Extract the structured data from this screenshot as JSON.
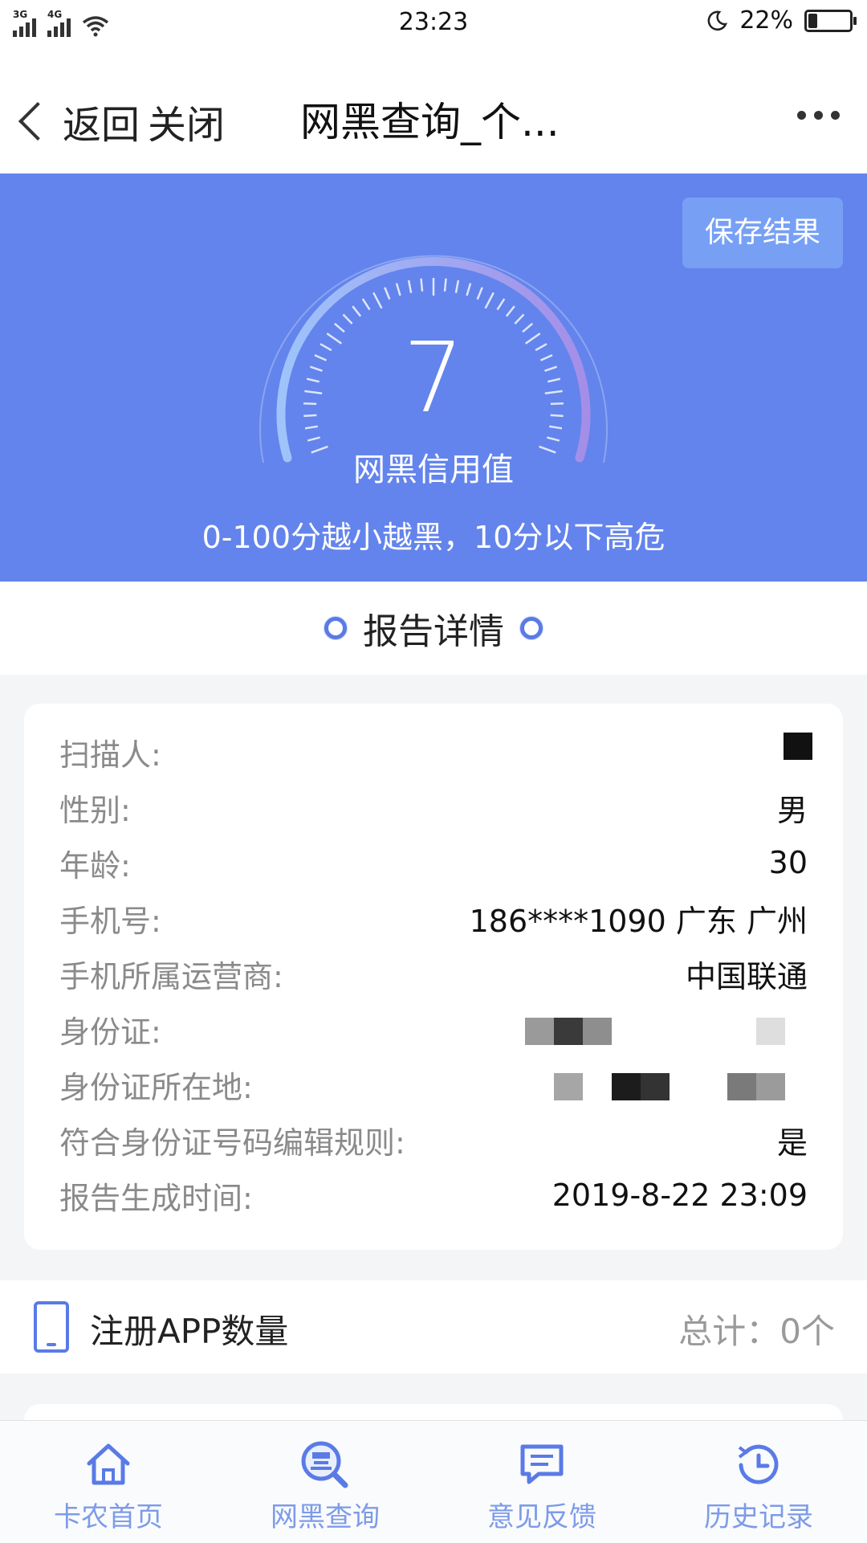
{
  "status_bar": {
    "time": "23:23",
    "battery": "22%",
    "battery_level": 0.22,
    "net1": "3G",
    "net2": "4G"
  },
  "nav": {
    "back": "返回",
    "close": "关闭",
    "title": "网黑查询_个..."
  },
  "hero": {
    "save_button": "保存结果",
    "score": "7",
    "score_label": "网黑信用值",
    "subtitle": "0-100分越小越黑，10分以下高危",
    "score_fraction": 0.07
  },
  "report": {
    "section_title": "报告详情",
    "rows": [
      {
        "label": "扫描人:",
        "value": ""
      },
      {
        "label": "性别:",
        "value": "男"
      },
      {
        "label": "年龄:",
        "value": "30"
      },
      {
        "label": "手机号:",
        "value": "186****1090 广东 广州"
      },
      {
        "label": "手机所属运营商:",
        "value": "中国联通"
      },
      {
        "label": "身份证:",
        "value": ""
      },
      {
        "label": "身份证所在地:",
        "value": ""
      },
      {
        "label": "符合身份证号码编辑规则:",
        "value": "是"
      },
      {
        "label": "报告生成时间:",
        "value": "2019-8-22 23:09"
      }
    ]
  },
  "app_count": {
    "label": "注册APP数量",
    "total": "总计：0个"
  },
  "tabs": [
    {
      "label": "卡农首页",
      "icon": "home-icon"
    },
    {
      "label": "网黑查询",
      "icon": "search-black-icon"
    },
    {
      "label": "意见反馈",
      "icon": "feedback-icon"
    },
    {
      "label": "历史记录",
      "icon": "history-icon"
    }
  ],
  "colors": {
    "hero_bg": "#6384ec",
    "accent": "#5a7be6",
    "tab_text": "#7d9be8"
  }
}
